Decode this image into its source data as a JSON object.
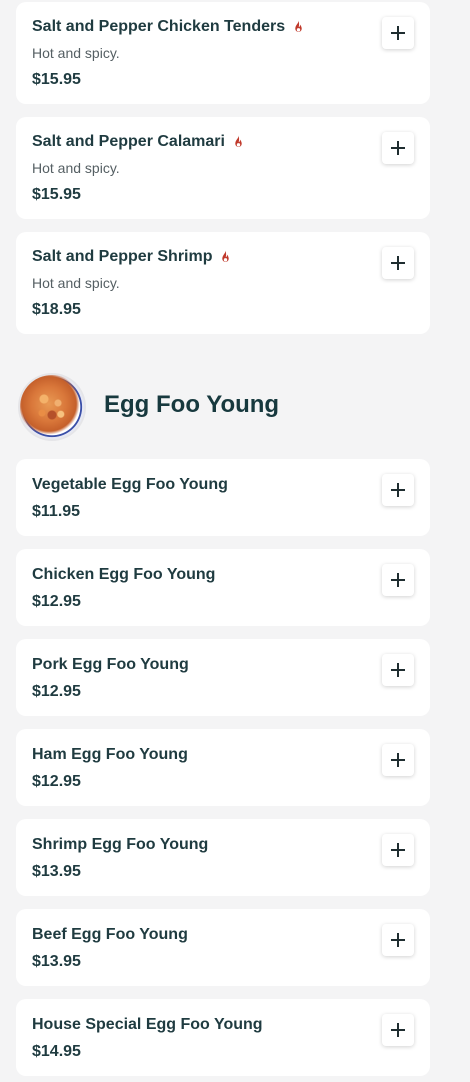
{
  "top_items": [
    {
      "name": "Salt and Pepper Chicken Tenders",
      "description": "Hot and spicy.",
      "price": "$15.95",
      "spicy_icon": "flame-icon"
    },
    {
      "name": "Salt and Pepper Calamari",
      "description": "Hot and spicy.",
      "price": "$15.95",
      "spicy_icon": "flame-icon"
    },
    {
      "name": "Salt and Pepper Shrimp",
      "description": "Hot and spicy.",
      "price": "$18.95",
      "spicy_icon": "flame-icon"
    }
  ],
  "section": {
    "title": "Egg Foo Young",
    "image_icon": "egg-foo-young-photo"
  },
  "section_items": [
    {
      "name": "Vegetable Egg Foo Young",
      "price": "$11.95"
    },
    {
      "name": "Chicken Egg Foo Young",
      "price": "$12.95"
    },
    {
      "name": "Pork Egg Foo Young",
      "price": "$12.95"
    },
    {
      "name": "Ham Egg Foo Young",
      "price": "$12.95"
    },
    {
      "name": "Shrimp Egg Foo Young",
      "price": "$13.95"
    },
    {
      "name": "Beef Egg Foo Young",
      "price": "$13.95"
    },
    {
      "name": "House Special Egg Foo Young",
      "price": "$14.95"
    }
  ],
  "add_icon": "plus-icon",
  "colors": {
    "spicy": "#c0392b",
    "text": "#1f3b40",
    "background": "#f4f4f5"
  }
}
